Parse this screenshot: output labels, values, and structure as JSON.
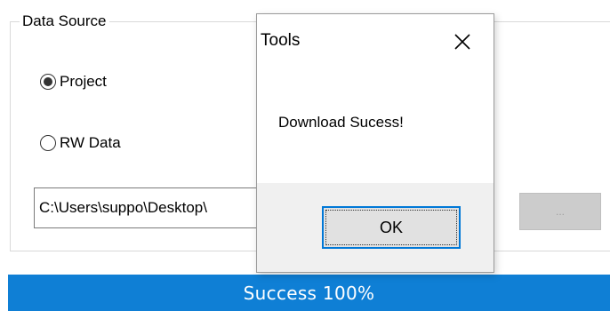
{
  "group": {
    "title": "Data Source"
  },
  "options": [
    {
      "label": "Project",
      "selected": true
    },
    {
      "label": "RW Data",
      "selected": false
    }
  ],
  "path_input": {
    "value": "C:\\Users\\suppo\\Desktop\\"
  },
  "browse_button": {
    "label": "..."
  },
  "progress": {
    "text": "Success 100%",
    "percent": 100,
    "color": "#0f7fd5"
  },
  "dialog": {
    "title": "Tools",
    "close_icon": "close-icon",
    "message": "Download Sucess!",
    "ok_label": "OK"
  },
  "colors": {
    "accent": "#0078d7",
    "dialog_footer": "#f0f0f0"
  }
}
